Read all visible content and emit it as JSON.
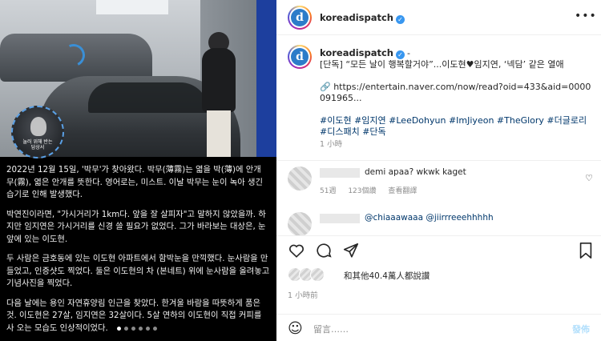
{
  "header": {
    "username": "koreadispatch",
    "avatar_letter": "d",
    "more_label": "•••"
  },
  "media": {
    "inset_caption": "눌러 위해 반는\n담상서",
    "caption_paragraphs": [
      "2022년 12월 15일, '박무'가 찾아왔다. 박무(薄霧)는 엷을 박(薄)에 안개 무(霧), 엷은 안개를 뜻한다. 영어로는, 미스트. 이날 박무는 눈이 녹아 생긴 습기로 인해 발생했다.",
      "박연진이라면, \"가시거리가 1km다. 앞을 잘 살피자\"고 말하지 않았을까. 하지만 임지연은 가시거리를 신경 쓸 필요가 없었다. 그가 바라보는 대상은, 눈앞에 있는 이도현.",
      "두 사람은 금호동에 있는 이도현 아파트에서 함박눈을 만끽했다. 눈사람을 만들었고, 인증샷도 찍었다. 둘은 이도현의 차 (본네트) 위에 눈사람을 올려놓고 기념사진을 찍었다.",
      "다음 날에는 용인 자연휴양림 인근을 찾았다. 한겨울 바람을 따뜻하게 품은 것. 이도현은 27살, 임지연은 32살이다. 5살 연하의 이도현이 직접 커피를 사 오는 모습도 인상적이었다."
    ],
    "carousel_total": 6,
    "carousel_active": 1
  },
  "post": {
    "username": "koreadispatch",
    "dash": "-",
    "caption_line1": "[단독] “모든 날이 행복할거야”...이도현♥임지연, ‘넥담’ 같은 열애",
    "link_icon": "🔗",
    "link": "https://entertain.naver.com/now/read?oid=433&aid=0000091965...",
    "hashtags": "#이도현 #임지연 #LeeDohyun #ImJiyeon #TheGlory #더글로리 #디스패치 #단독",
    "time_ago": "1 小時"
  },
  "comments": [
    {
      "text": "demi apaa? wkwk kaget",
      "is_mention": false,
      "weeks": "51週",
      "likes": "123個讚",
      "reply": "查看翻譯"
    },
    {
      "text": "@chiaaawaaa @jiirrreeehhhhh",
      "is_mention": true,
      "weeks": "",
      "likes": "",
      "reply": ""
    }
  ],
  "likes_text": "和其他40.4萬人都說讚",
  "post_time": "1 小時前",
  "add_comment": {
    "placeholder": "留言……",
    "post_label": "發佈"
  }
}
